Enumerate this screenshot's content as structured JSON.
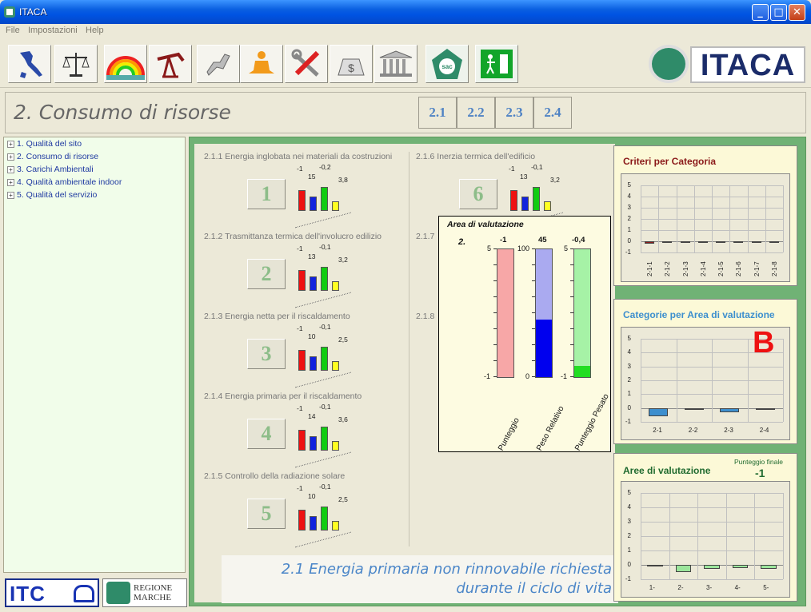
{
  "window": {
    "title": "ITACA",
    "minimize": "_",
    "maximize": "□",
    "close": "✕"
  },
  "menu": [
    "File",
    "Impostazioni",
    "Help"
  ],
  "toolbar": {
    "icons": [
      "italy-map-icon",
      "scales-icon",
      "rainbow-icon",
      "oil-pump-icon",
      "plug-icon",
      "meditation-icon",
      "tools-icon",
      "money-bag-icon",
      "building-icon",
      "sac-logo-icon",
      "exit-icon"
    ]
  },
  "logo": {
    "text": "ITACA",
    "emblem": "sac"
  },
  "header": {
    "title": "2. Consumo di risorse",
    "tabs": [
      "2.1",
      "2.2",
      "2.3",
      "2.4"
    ]
  },
  "tree": [
    "1. Qualità del sito",
    "2. Consumo di risorse",
    "3. Carichi Ambientali",
    "4. Qualità ambientale indoor",
    "5. Qualità del servizio"
  ],
  "bottom_logos": {
    "itc": "ITC",
    "regione": [
      "REGIONE",
      "MARCHE"
    ]
  },
  "criteria": [
    {
      "num": "1",
      "label": "2.1.1 Energia inglobata nei materiali da costruzioni",
      "vals": [
        "-1",
        "15",
        "-0,2",
        "3,8"
      ]
    },
    {
      "num": "2",
      "label": "2.1.2 Trasmittanza termica dell'involucro edilizio",
      "vals": [
        "-1",
        "13",
        "-0,1",
        "3,2"
      ]
    },
    {
      "num": "3",
      "label": "2.1.3 Energia netta per il riscaldamento",
      "vals": [
        "-1",
        "10",
        "-0,1",
        "2,5"
      ]
    },
    {
      "num": "4",
      "label": "2.1.4 Energia primaria per il riscaldamento",
      "vals": [
        "-1",
        "14",
        "-0,1",
        "3,6"
      ]
    },
    {
      "num": "5",
      "label": "2.1.5 Controllo della radiazione solare",
      "vals": [
        "-1",
        "10",
        "-0,1",
        "2,5"
      ]
    },
    {
      "num": "6",
      "label": "2.1.6 Inerzia termica dell'edificio",
      "vals": [
        "-1",
        "13",
        "-0,1",
        "3,2"
      ]
    },
    {
      "num": "",
      "label": "2.1.7",
      "vals": []
    },
    {
      "num": "",
      "label": "2.1.8",
      "vals": []
    }
  ],
  "popup": {
    "title": "Area di valutazione",
    "code": "2.",
    "columns": [
      {
        "label": "Punteggio",
        "value": "-1",
        "top": "5",
        "bottom": "-1",
        "level": 0,
        "color": "#f7a7a7"
      },
      {
        "label": "Peso Relativo",
        "value": "45",
        "top": "100",
        "bottom": "0",
        "level": 0.45,
        "color": "#0000ee"
      },
      {
        "label": "Punteggio Pesato",
        "value": "-0,4",
        "top": "5",
        "bottom": "-1",
        "level": 0.1,
        "color": "#22dd22"
      }
    ]
  },
  "footer": {
    "line1": "2.1 Energia primaria non rinnovabile richiesta",
    "line2": "durante il ciclo di vita"
  },
  "chart_data": [
    {
      "type": "bar",
      "title": "Criteri per Categoria",
      "categories": [
        "2-1-1",
        "2-1-2",
        "2-1-3",
        "2-1-4",
        "2-1-5",
        "2-1-6",
        "2-1-7",
        "2-1-8"
      ],
      "values": [
        -0.2,
        -0.1,
        -0.1,
        -0.1,
        -0.1,
        -0.1,
        -0.1,
        -0.1
      ],
      "ylim": [
        -1,
        5
      ],
      "yticks": [
        "5",
        "4",
        "3",
        "2",
        "1",
        "0",
        "-1"
      ],
      "color": "#8b1a1a"
    },
    {
      "type": "bar",
      "title": "Categorie per Area di valutazione",
      "categories": [
        "2-1",
        "2-2",
        "2-3",
        "2-4"
      ],
      "values": [
        -0.6,
        -0.1,
        -0.3,
        -0.1
      ],
      "ylim": [
        -1,
        5
      ],
      "yticks": [
        "5",
        "4",
        "3",
        "2",
        "1",
        "0",
        "-1"
      ],
      "color": "#3d8fce",
      "badge": "B"
    },
    {
      "type": "bar",
      "title": "Aree di valutazione",
      "categories": [
        "1-",
        "2-",
        "3-",
        "4-",
        "5-"
      ],
      "values": [
        -0.05,
        -0.5,
        -0.3,
        -0.2,
        -0.3
      ],
      "ylim": [
        -1,
        5
      ],
      "yticks": [
        "5",
        "4",
        "3",
        "2",
        "1",
        "0",
        "-1"
      ],
      "color": "#9be59b",
      "note_label": "Punteggio finale",
      "note_value": "-1"
    }
  ]
}
